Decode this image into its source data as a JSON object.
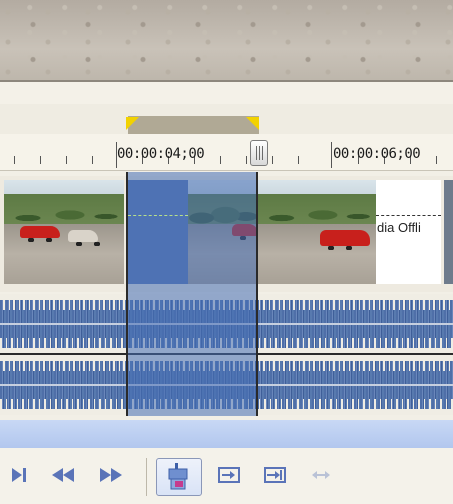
{
  "timeline": {
    "ruler": {
      "timecodes": [
        "00:00:04;00",
        "00:00:06;00"
      ]
    },
    "video_track": {
      "offline_text": "dia Offli"
    }
  },
  "toolbar": {
    "buttons": [
      {
        "name": "go-to-end-button",
        "icon": "skip-to-end-icon"
      },
      {
        "name": "rewind-button",
        "icon": "rewind-icon"
      },
      {
        "name": "fast-forward-button",
        "icon": "fast-forward-icon"
      },
      {
        "name": "loop-playback-button",
        "icon": "loop-region-icon",
        "active": true
      },
      {
        "name": "move-in-point-button",
        "icon": "align-in-icon"
      },
      {
        "name": "move-out-point-button",
        "icon": "align-out-icon"
      },
      {
        "name": "span-button",
        "icon": "span-icon",
        "disabled": true
      }
    ]
  },
  "colors": {
    "selection": "#466eb4",
    "waveform": "#4f6fa8",
    "loop_flag": "#f2d200",
    "loop_region": "#b0a995"
  }
}
